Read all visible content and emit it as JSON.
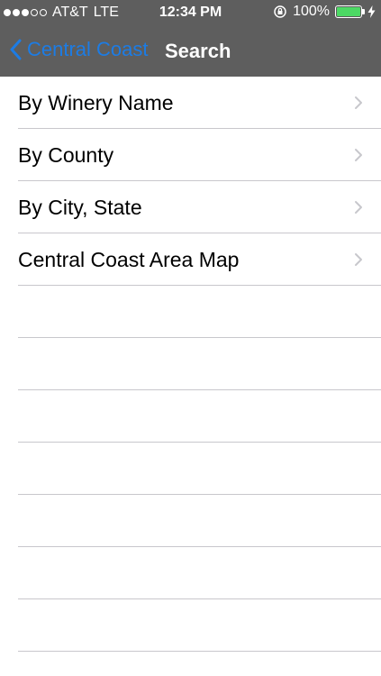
{
  "status_bar": {
    "carrier": "AT&T",
    "network": "LTE",
    "time": "12:34 PM",
    "battery": "100%",
    "signal_bars_filled": 3,
    "signal_bars_total": 5,
    "battery_level": 1.0,
    "colors": {
      "battery_fill": "#4cd964"
    }
  },
  "nav_bar": {
    "back_label": "Central Coast",
    "title": "Search",
    "colors": {
      "background": "#5e5e5e",
      "back_tint": "#1c7ce5"
    }
  },
  "menu": {
    "items": [
      {
        "label": "By Winery Name",
        "icon": "chevron-right-icon"
      },
      {
        "label": "By County",
        "icon": "chevron-right-icon"
      },
      {
        "label": "By City, State",
        "icon": "chevron-right-icon"
      },
      {
        "label": "Central Coast Area Map",
        "icon": "chevron-right-icon"
      }
    ]
  }
}
